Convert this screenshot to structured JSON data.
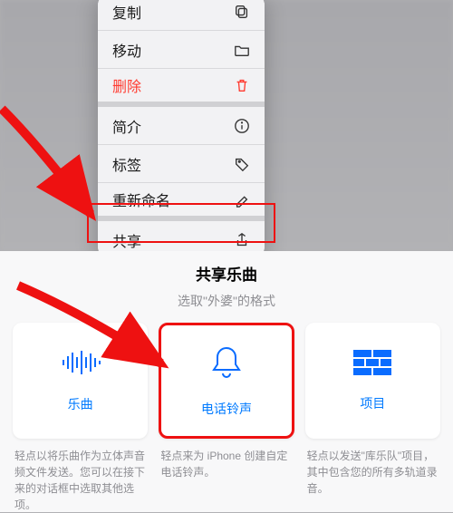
{
  "menu": {
    "items": [
      {
        "label": "复制",
        "icon": "copy-icon",
        "danger": false
      },
      {
        "label": "移动",
        "icon": "folder-icon",
        "danger": false
      },
      {
        "label": "删除",
        "icon": "trash-icon",
        "danger": true
      },
      {
        "label": "简介",
        "icon": "info-icon",
        "danger": false
      },
      {
        "label": "标签",
        "icon": "tag-icon",
        "danger": false
      },
      {
        "label": "重新命名",
        "icon": "pencil-icon",
        "danger": false
      },
      {
        "label": "共享",
        "icon": "share-icon",
        "danger": false
      }
    ]
  },
  "sheet": {
    "title": "共享乐曲",
    "subtitle": "选取\"外婆\"的格式",
    "tiles": [
      {
        "key": "song",
        "label": "乐曲",
        "desc": "轻点以将乐曲作为立体声音频文件发送。您可以在接下来的对话框中选取其他选项。"
      },
      {
        "key": "ringtone",
        "label": "电话铃声",
        "desc": "轻点来为 iPhone 创建自定电话铃声。"
      },
      {
        "key": "project",
        "label": "项目",
        "desc": "轻点以发送\"库乐队\"项目，其中包含您的所有多轨道录音。"
      }
    ]
  },
  "colors": {
    "accent": "#007aff",
    "danger": "#ff3b30",
    "highlight": "#e11"
  }
}
